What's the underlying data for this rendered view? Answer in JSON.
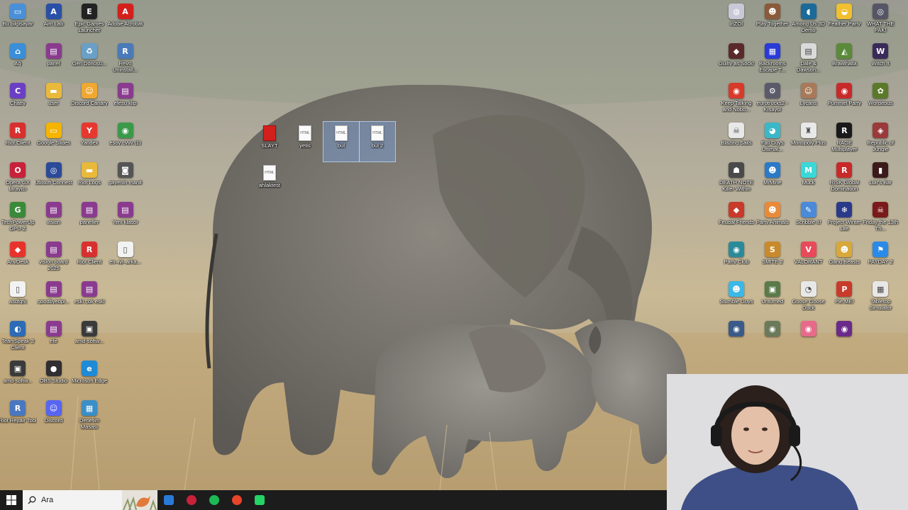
{
  "desktop": {
    "left_icons": [
      {
        "label": "Bu bilgisayar",
        "icon": "computer-icon",
        "color": "#4a90d9",
        "glyph": "▭"
      },
      {
        "label": "Aim Lab",
        "icon": "aimlab-icon",
        "color": "#2a4fa8",
        "glyph": "A"
      },
      {
        "label": "Epic Games Launcher",
        "icon": "epic-games-icon",
        "color": "#222222",
        "glyph": "E"
      },
      {
        "label": "Adobe Acrobat",
        "icon": "acrobat-icon",
        "color": "#d4201c",
        "glyph": "A"
      },
      {
        "label": "Ağ",
        "icon": "network-icon",
        "color": "#3a8fd8",
        "glyph": "⌂"
      },
      {
        "label": "panel",
        "icon": "winrar-icon",
        "color": "#8a3b8f",
        "glyph": "▤"
      },
      {
        "label": "Geri Dönüşü...",
        "icon": "recycle-bin-icon",
        "color": "#6aa0c8",
        "glyph": "♻"
      },
      {
        "label": "Revo Uninstall...",
        "icon": "revo-icon",
        "color": "#4a7ab8",
        "glyph": "R"
      },
      {
        "label": "Chatty",
        "icon": "chatty-icon",
        "color": "#6a3fc4",
        "glyph": "C"
      },
      {
        "label": "user",
        "icon": "folder-icon",
        "color": "#e8b93a",
        "glyph": "▬"
      },
      {
        "label": "Discord Canary",
        "icon": "discord-canary-icon",
        "color": "#f0a830",
        "glyph": "☺"
      },
      {
        "label": "efesu klip",
        "icon": "winrar-icon",
        "color": "#8a3b8f",
        "glyph": "▤"
      },
      {
        "label": "Riot Client",
        "icon": "riot-client-icon",
        "color": "#d8302f",
        "glyph": "R"
      },
      {
        "label": "Google Slides",
        "icon": "google-slides-icon",
        "color": "#f4b400",
        "glyph": "▭"
      },
      {
        "label": "Yandex",
        "icon": "yandex-icon",
        "color": "#e6382f",
        "glyph": "Y"
      },
      {
        "label": "esoy cvvv (1)",
        "icon": "chrome-icon",
        "color": "#3a9a4a",
        "glyph": "◉"
      },
      {
        "label": "Opera GX tarayıcı",
        "icon": "opera-gx-icon",
        "color": "#c8223a",
        "glyph": "O"
      },
      {
        "label": "Ubisoft Connect",
        "icon": "ubisoft-icon",
        "color": "#2b4b9a",
        "glyph": "◎"
      },
      {
        "label": "Riot Logs",
        "icon": "folder-icon",
        "color": "#e8b93a",
        "glyph": "▬"
      },
      {
        "label": "gayenin manit",
        "icon": "image-file-icon",
        "color": "#555555",
        "glyph": "◙"
      },
      {
        "label": "TechPowerUp GPU-Z",
        "icon": "gpuz-icon",
        "color": "#3a8a3a",
        "glyph": "G"
      },
      {
        "label": "vision",
        "icon": "winrar-icon",
        "color": "#8a3b8f",
        "glyph": "▤"
      },
      {
        "label": "paneller",
        "icon": "winrar-icon",
        "color": "#8a3b8f",
        "glyph": "▤"
      },
      {
        "label": "Yeni klasör",
        "icon": "winrar-icon",
        "color": "#8a3b8f",
        "glyph": "▤"
      },
      {
        "label": "AnyDesk",
        "icon": "anydesk-icon",
        "color": "#e8332d",
        "glyph": "◆"
      },
      {
        "label": "vision board 2025",
        "icon": "winrar-icon",
        "color": "#8a3b8f",
        "glyph": "▤"
      },
      {
        "label": "Riot Client",
        "icon": "riot-client-icon",
        "color": "#d8302f",
        "glyph": "R"
      },
      {
        "label": "en_iyi_arka...",
        "icon": "html-file-icon",
        "color": "#f2f2f2",
        "glyph": "▯"
      },
      {
        "label": "asdfghj",
        "icon": "text-file-icon",
        "color": "#f2f2f2",
        "glyph": "▯"
      },
      {
        "label": "goodbyedpi...",
        "icon": "winrar-icon",
        "color": "#8a3b8f",
        "glyph": "▤"
      },
      {
        "label": "eski çok eski",
        "icon": "winrar-icon",
        "color": "#8a3b8f",
        "glyph": "▤"
      },
      {
        "label": "",
        "icon": "empty-slot",
        "color": "",
        "glyph": ""
      },
      {
        "label": "TeamSpeak 3 Client",
        "icon": "teamspeak-icon",
        "color": "#2c6bb5",
        "glyph": "◐"
      },
      {
        "label": "efe",
        "icon": "winrar-icon",
        "color": "#8a3b8f",
        "glyph": "▤"
      },
      {
        "label": "amd-softw...",
        "icon": "amd-installer-icon",
        "color": "#3a3a3a",
        "glyph": "▣"
      },
      {
        "label": "",
        "icon": "empty-slot",
        "color": "",
        "glyph": ""
      },
      {
        "label": "amd-softw...",
        "icon": "amd-installer-icon",
        "color": "#3a3a3a",
        "glyph": "▣"
      },
      {
        "label": "OBS Studio",
        "icon": "obs-icon",
        "color": "#302e31",
        "glyph": "●"
      },
      {
        "label": "Microsoft Edge",
        "icon": "edge-icon",
        "color": "#1f8ad6",
        "glyph": "e"
      },
      {
        "label": "",
        "icon": "empty-slot",
        "color": "",
        "glyph": ""
      },
      {
        "label": "Riot Repair Tool",
        "icon": "riot-repair-icon",
        "color": "#4a78c0",
        "glyph": "R"
      },
      {
        "label": "Discord",
        "icon": "discord-icon",
        "color": "#5865f2",
        "glyph": "☺"
      },
      {
        "label": "Denetim Masası",
        "icon": "control-panel-icon",
        "color": "#3a8fc8",
        "glyph": "▦"
      }
    ],
    "middle_icons": [
      {
        "label": "SLAYT",
        "icon": "pdf-file-icon",
        "selected": false
      },
      {
        "label": "yetis",
        "icon": "html-file-icon",
        "selected": false
      },
      {
        "label": "bul",
        "icon": "html-file-icon",
        "selected": true
      },
      {
        "label": "bul 2",
        "icon": "html-file-icon",
        "selected": true
      },
      {
        "label": "ahlaktest",
        "icon": "html-file-icon",
        "selected": false
      }
    ],
    "right_icons": [
      {
        "label": "inZOI",
        "icon": "inzoi-icon",
        "color": "#c8c8d8",
        "glyph": "◍"
      },
      {
        "label": "Play Together",
        "icon": "play-together-icon",
        "color": "#8a5a3a",
        "glyph": "☻"
      },
      {
        "label": "Among Us 3D Demo",
        "icon": "among-us-icon",
        "color": "#1a6a9a",
        "glyph": "◖"
      },
      {
        "label": "Feather Party",
        "icon": "feather-party-icon",
        "color": "#f0c030",
        "glyph": "◒"
      },
      {
        "label": "WHAT THE PAK!",
        "icon": "what-the-pak-icon",
        "color": "#555566",
        "glyph": "◎"
      },
      {
        "label": "Guilty as Sock!",
        "icon": "guilty-as-sock-icon",
        "color": "#5a2a2a",
        "glyph": "◆"
      },
      {
        "label": "Backrooms Escape T...",
        "icon": "backrooms-icon",
        "color": "#2a3ad8",
        "glyph": "▦"
      },
      {
        "label": "Dale & Dawson...",
        "icon": "dale-dawson-icon",
        "color": "#dadada",
        "glyph": "▤"
      },
      {
        "label": "Brawlhalla",
        "icon": "brawlhalla-icon",
        "color": "#5a8a3a",
        "glyph": "◭"
      },
      {
        "label": "Witch It",
        "icon": "witch-it-icon",
        "color": "#3a2a5a",
        "glyph": "W"
      },
      {
        "label": "Keep Talking and Nobo...",
        "icon": "keep-talking-icon",
        "color": "#d83a2a",
        "glyph": "◉"
      },
      {
        "label": "eurotrucks2 - Kısayol",
        "icon": "eurotruck-icon",
        "color": "#5a5a6a",
        "glyph": "⚙"
      },
      {
        "label": "Lycans",
        "icon": "lycans-icon",
        "color": "#a87a5a",
        "glyph": "☺"
      },
      {
        "label": "Pummel Party",
        "icon": "pummel-party-icon",
        "color": "#c82a2a",
        "glyph": "◉"
      },
      {
        "label": "Wordeous",
        "icon": "wordeous-icon",
        "color": "#5a7a2a",
        "glyph": "✿"
      },
      {
        "label": "Blazing Sails",
        "icon": "blazing-sails-icon",
        "color": "#e8e8e8",
        "glyph": "☠"
      },
      {
        "label": "Fall Guys Ultimat...",
        "icon": "fall-guys-icon",
        "color": "#3ab8c8",
        "glyph": "◕"
      },
      {
        "label": "Monopoly Plus",
        "icon": "monopoly-icon",
        "color": "#e8e8e8",
        "glyph": "♜"
      },
      {
        "label": "RAGE Multiplayer",
        "icon": "rage-mp-icon",
        "color": "#1a1a1a",
        "glyph": "R"
      },
      {
        "label": "Republic of Jungle",
        "icon": "republic-jungle-icon",
        "color": "#9a3a3a",
        "glyph": "◈"
      },
      {
        "label": "DEATH NOTE Killer Within",
        "icon": "death-note-icon",
        "color": "#4a4a4a",
        "glyph": "☗"
      },
      {
        "label": "MrMine",
        "icon": "mrmine-icon",
        "color": "#2a7ac8",
        "glyph": "☻"
      },
      {
        "label": "Muck",
        "icon": "muck-icon",
        "color": "#3ad8d8",
        "glyph": "M"
      },
      {
        "label": "RISK Global Domination",
        "icon": "risk-icon",
        "color": "#c82a2a",
        "glyph": "R"
      },
      {
        "label": "Liar's Bar",
        "icon": "liars-bar-icon",
        "color": "#3a1a1a",
        "glyph": "▮"
      },
      {
        "label": "Feudal Friends",
        "icon": "feudal-friends-icon",
        "color": "#c83a2a",
        "glyph": "◆"
      },
      {
        "label": "Party Animals",
        "icon": "party-animals-icon",
        "color": "#e88a3a",
        "glyph": "☻"
      },
      {
        "label": "Scribble It!",
        "icon": "scribble-it-icon",
        "color": "#4a8ad8",
        "glyph": "✎"
      },
      {
        "label": "Project Winter Lite",
        "icon": "project-winter-icon",
        "color": "#2a3a8a",
        "glyph": "❄"
      },
      {
        "label": "Friday the 13th Th...",
        "icon": "friday13-icon",
        "color": "#7a1a1a",
        "glyph": "☠"
      },
      {
        "label": "Party Club",
        "icon": "party-club-icon",
        "color": "#2a8a9a",
        "glyph": "◉"
      },
      {
        "label": "SMITE 2",
        "icon": "smite-icon",
        "color": "#c88a2a",
        "glyph": "S"
      },
      {
        "label": "VALORANT",
        "icon": "valorant-icon",
        "color": "#e84a5a",
        "glyph": "V"
      },
      {
        "label": "Gang Beasts",
        "icon": "gang-beasts-icon",
        "color": "#d8a83a",
        "glyph": "☻"
      },
      {
        "label": "PAYDAY 2",
        "icon": "payday-icon",
        "color": "#2a8ae8",
        "glyph": "⚑"
      },
      {
        "label": "Stumble Guys",
        "icon": "stumble-guys-icon",
        "color": "#3ab8e8",
        "glyph": "☻"
      },
      {
        "label": "Unturned",
        "icon": "unturned-icon",
        "color": "#5a7a4a",
        "glyph": "▣"
      },
      {
        "label": "Goose Goose Duck",
        "icon": "goose-duck-icon",
        "color": "#e8e8e8",
        "glyph": "◔"
      },
      {
        "label": "Pie.ME!",
        "icon": "pie-me-icon",
        "color": "#c83a2a",
        "glyph": "P"
      },
      {
        "label": "Tabletop Simulator",
        "icon": "tabletop-icon",
        "color": "#e8e8e8",
        "glyph": "▦"
      },
      {
        "label": "",
        "icon": "partial-game-icon",
        "color": "#3a5a8a",
        "glyph": "◉"
      },
      {
        "label": "",
        "icon": "partial-game-icon",
        "color": "#6a7a5a",
        "glyph": "◉"
      },
      {
        "label": "",
        "icon": "partial-game-icon",
        "color": "#e86a8a",
        "glyph": "◉"
      },
      {
        "label": "",
        "icon": "partial-game-icon",
        "color": "#6a2a8a",
        "glyph": "◉"
      }
    ]
  },
  "taskbar": {
    "search_placeholder": "Ara",
    "apps": [
      {
        "name": "file-explorer-icon",
        "color": "#2a7ad8"
      },
      {
        "name": "opera-gx-taskbar-icon",
        "color": "#c8223a"
      },
      {
        "name": "spotify-icon",
        "color": "#1db954"
      },
      {
        "name": "chrome-taskbar-icon",
        "color": "#e8452a"
      },
      {
        "name": "whatsapp-icon",
        "color": "#25d366"
      }
    ]
  },
  "colors": {
    "taskbar_bg": "#1c1c1c",
    "selection": "#78a0dc"
  }
}
